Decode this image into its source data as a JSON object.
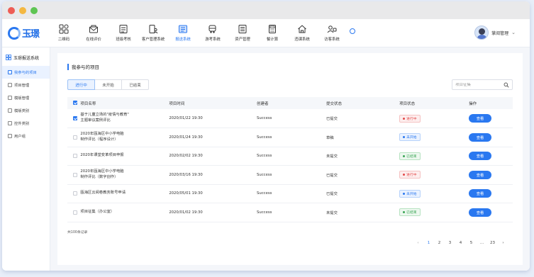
{
  "brand": {
    "name": "玉璟"
  },
  "nav": [
    {
      "label": "二维码",
      "icon": "qr-grid-icon"
    },
    {
      "label": "在线评价",
      "icon": "mail-icon"
    },
    {
      "label": "班级考核",
      "icon": "checklist-icon"
    },
    {
      "label": "客户管理系统",
      "icon": "person-doc-icon"
    },
    {
      "label": "报送系统",
      "icon": "report-icon",
      "active": true
    },
    {
      "label": "游考系统",
      "icon": "bus-icon"
    },
    {
      "label": "资产管理",
      "icon": "asset-doc-icon"
    },
    {
      "label": "餐计算",
      "icon": "calculator-icon"
    },
    {
      "label": "违课系统",
      "icon": "house-icon"
    },
    {
      "label": "访客系统",
      "icon": "visitor-icon"
    }
  ],
  "user": {
    "name": "掌阅管理"
  },
  "sidebar": {
    "title": "玉璟报送系统",
    "items": [
      {
        "label": "我参与的项目",
        "active": true
      },
      {
        "label": "项目管理"
      },
      {
        "label": "模版管理"
      },
      {
        "label": "模版类别"
      },
      {
        "label": "控件类别"
      },
      {
        "label": "用户组"
      }
    ]
  },
  "main": {
    "title": "我参与的项目",
    "tabs": [
      "进行中",
      "未开始",
      "已结束"
    ],
    "search_placeholder": "项目征集",
    "columns": [
      "项目名称",
      "项目时间",
      "创建者",
      "提交状态",
      "项目状态",
      "操作"
    ],
    "rows": [
      {
        "checked": true,
        "name": "基于儿童立场的\"疫情与教育\"\n主题审议案例评比",
        "time": "2020/01/22 19:30",
        "creator": "Success",
        "submit": "已提交",
        "state": "进行中",
        "state_color": "red",
        "op": "查看"
      },
      {
        "checked": false,
        "name": "2020年瓯海区中小学电脑\n制作评比（程序设计）",
        "time": "2020/01/24 19:30",
        "creator": "Success",
        "submit": "草稿",
        "state": "未开始",
        "state_color": "blue",
        "op": "查看"
      },
      {
        "checked": false,
        "name": "2020年课堂变革项目申报",
        "time": "2020/02/02 19:30",
        "creator": "Success",
        "submit": "未提交",
        "state": "已结束",
        "state_color": "green",
        "op": "查看"
      },
      {
        "checked": false,
        "name": "2020年瓯海区中小学电脑\n制作评比（数字创作）",
        "time": "2020/03/16 19:30",
        "creator": "Success",
        "submit": "已提交",
        "state": "进行中",
        "state_color": "red",
        "op": "查看"
      },
      {
        "checked": false,
        "name": "瓯海区云阅卷教务账号申请",
        "time": "2020/05/01 19:30",
        "creator": "Success",
        "submit": "已提交",
        "state": "未开始",
        "state_color": "blue",
        "op": "查看"
      },
      {
        "checked": false,
        "name": "项目征集（办公室）",
        "time": "2020/01/02 19:30",
        "creator": "Success",
        "submit": "未提交",
        "state": "已结束",
        "state_color": "green",
        "op": "查看"
      }
    ],
    "total_text": "共100条记录",
    "pager": {
      "prev": "‹",
      "pages": [
        "1",
        "2",
        "3",
        "4",
        "5"
      ],
      "ellipsis": "...",
      "last": "23",
      "next": "›",
      "current": "1"
    }
  },
  "colors": {
    "accent": "#2a78f0",
    "in_progress": "#e44b4b",
    "not_started": "#2a78f0",
    "ended": "#3aa655"
  }
}
